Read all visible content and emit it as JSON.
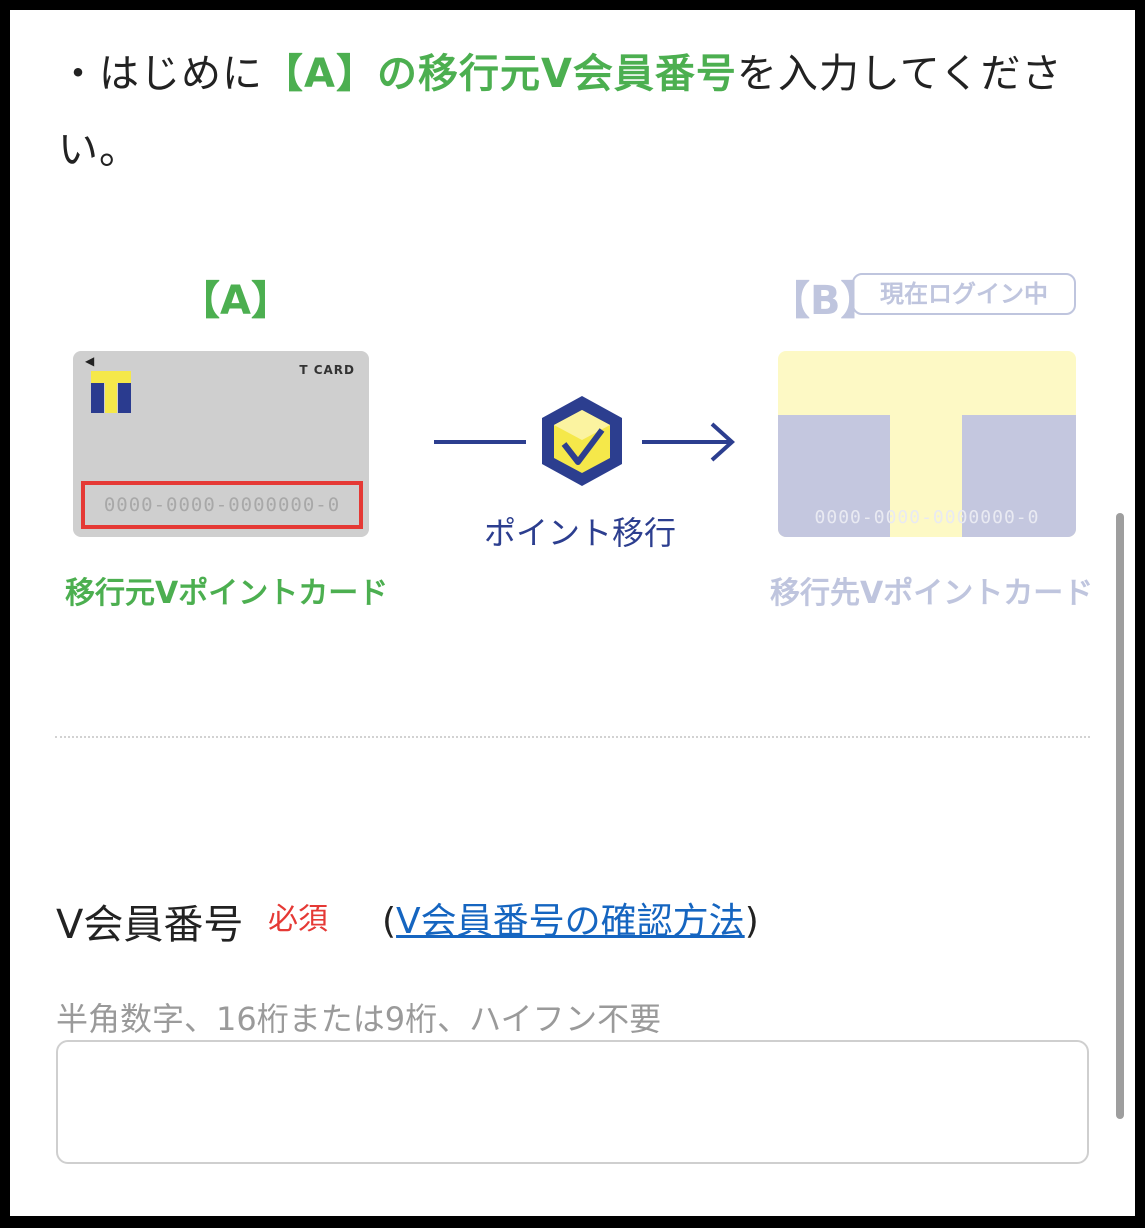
{
  "intro": {
    "prefix": "・はじめに",
    "highlight": "【A】の移行元V会員番号",
    "suffix": "を入力してください。"
  },
  "diagram": {
    "label_a": "【A】",
    "label_b": "【B】",
    "login_badge": "現在ログイン中",
    "card_a_brand": "T CARD",
    "card_a_number": "0000-0000-0000000-0",
    "card_b_number": "0000-0000-0000000-0",
    "flow_label": "ポイント移行",
    "caption_a": "移行元Vポイントカード",
    "caption_b": "移行先Vポイントカード",
    "colors": {
      "green": "#4caf50",
      "navy": "#2c3e8f",
      "red": "#e53935",
      "faded": "#bfc5de"
    }
  },
  "form": {
    "label": "V会員番号",
    "required": "必須",
    "help_open": "(",
    "help_link": "V会員番号の確認方法",
    "help_close": ")",
    "hint": "半角数字、16桁または9桁、ハイフン不要",
    "value": ""
  }
}
